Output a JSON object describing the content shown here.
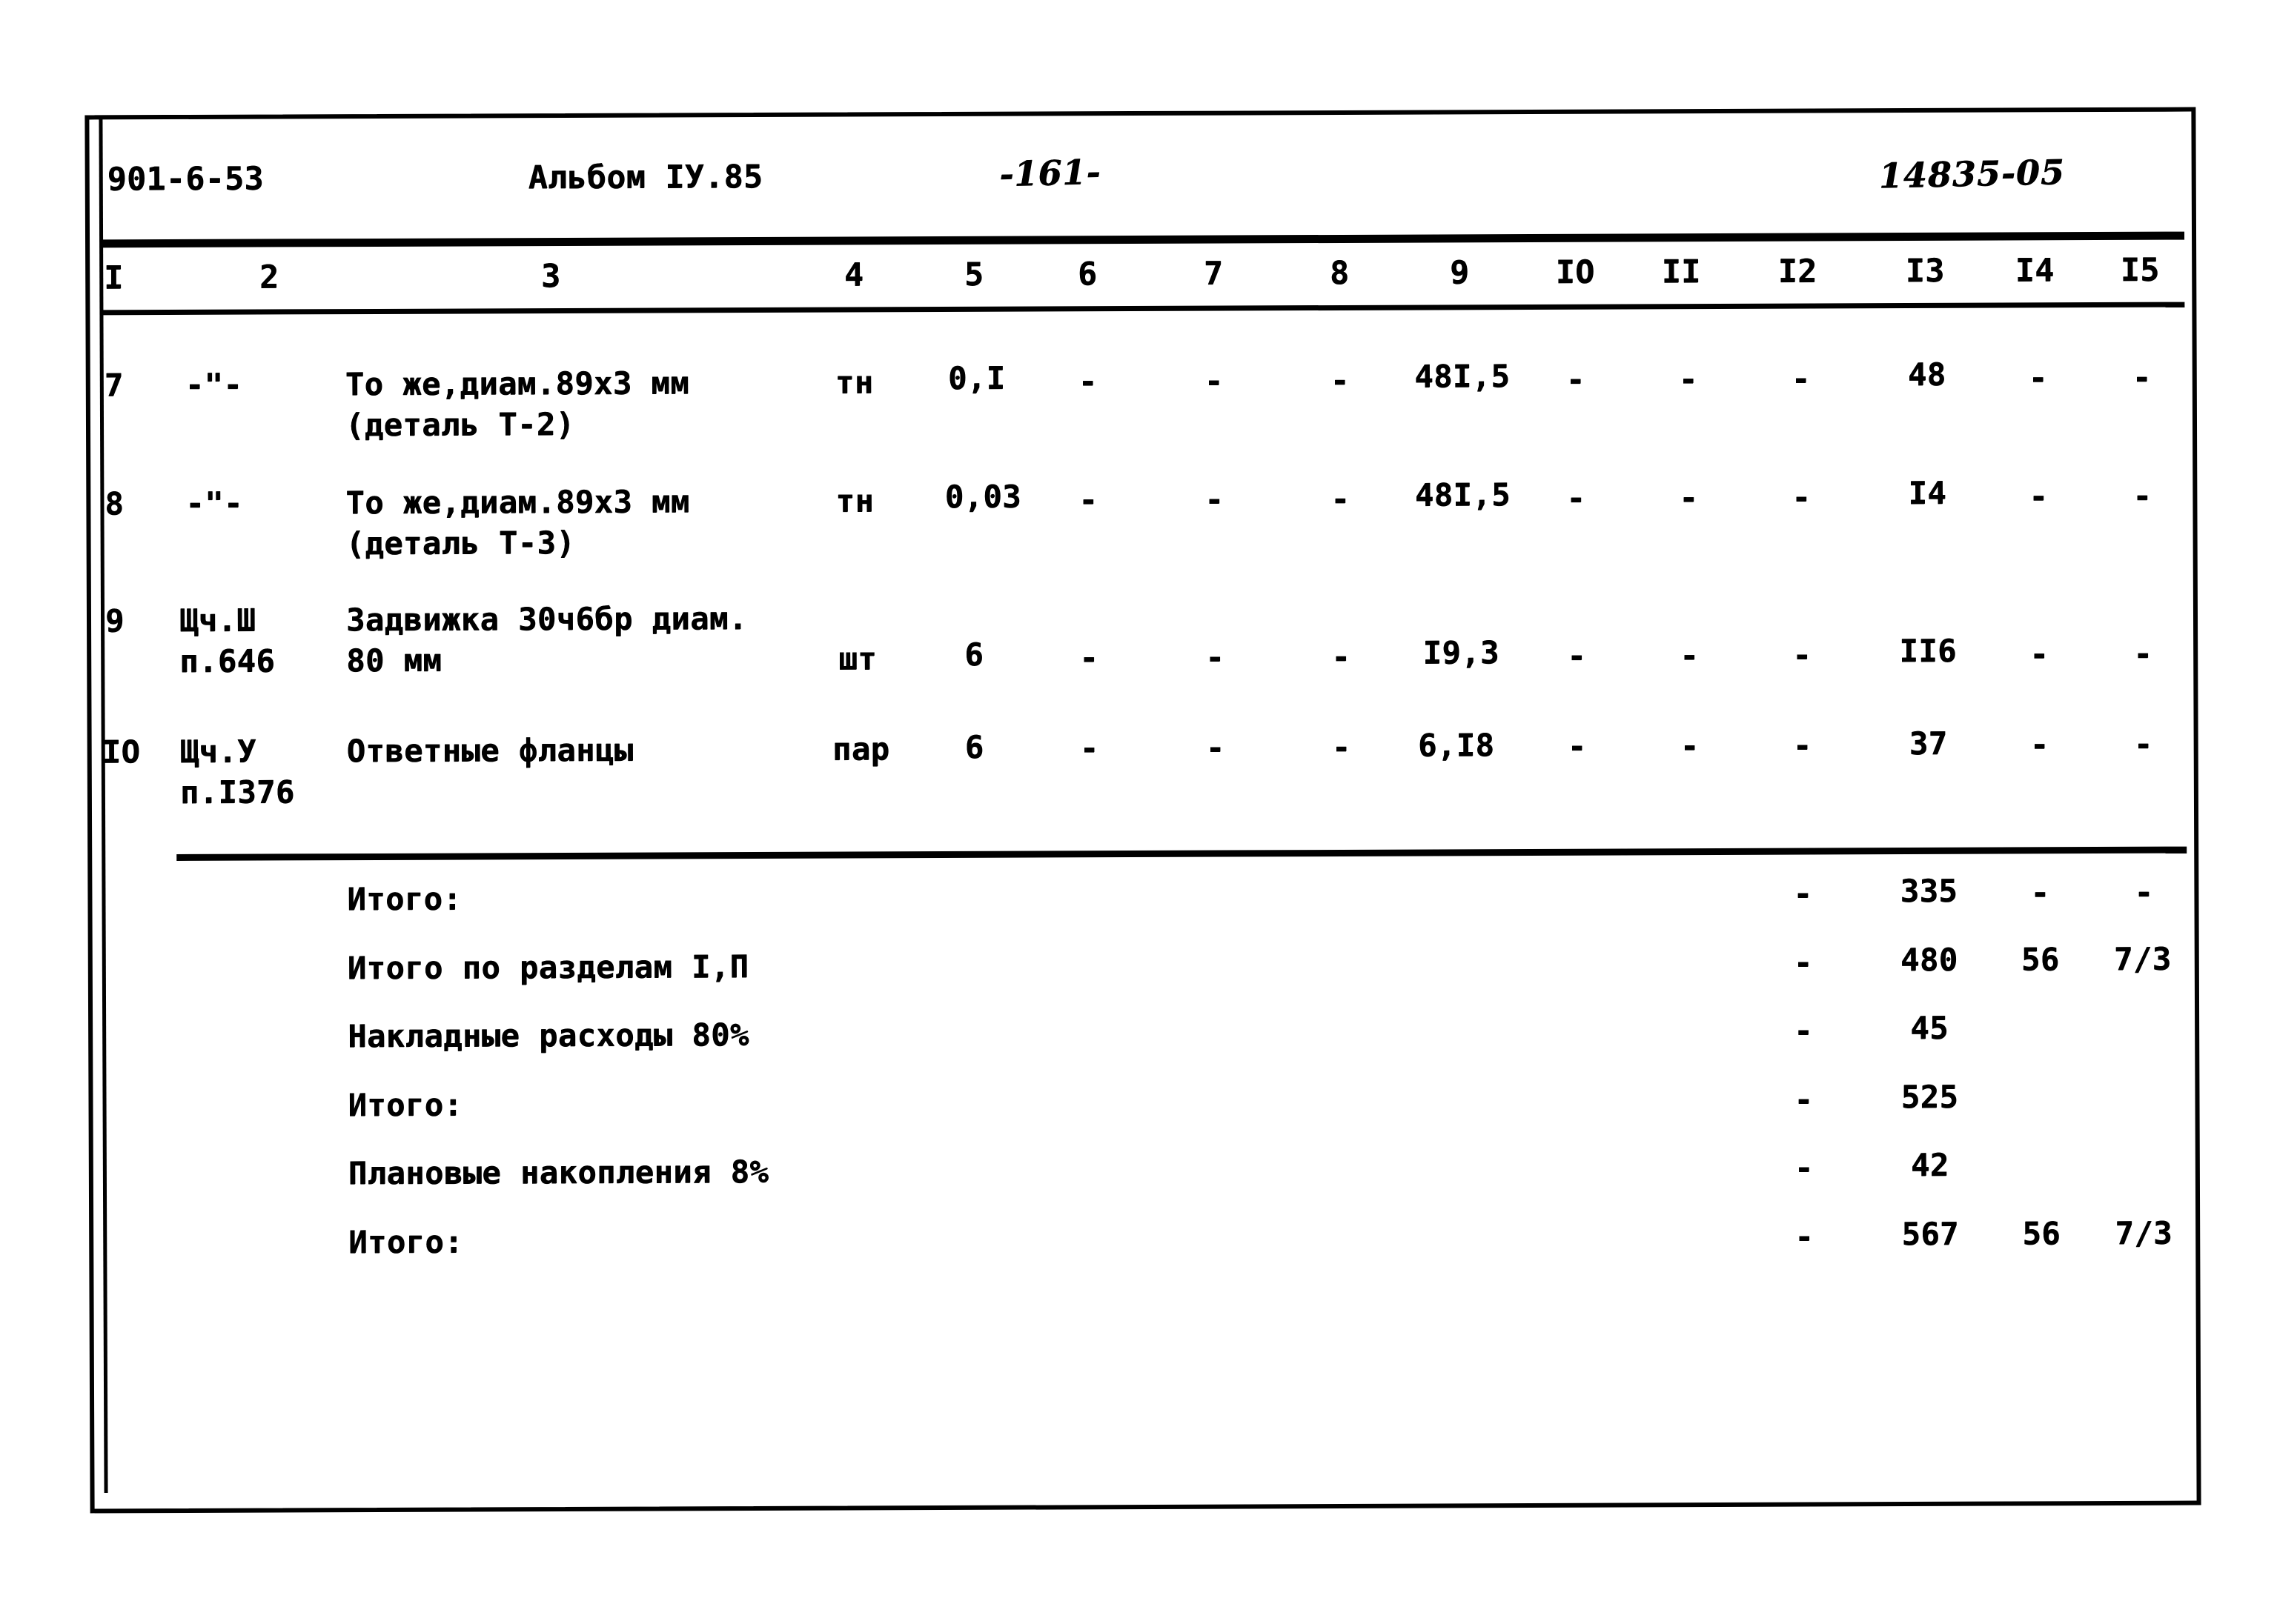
{
  "document": {
    "project_code": "901-6-53",
    "album": "Альбом IУ.85",
    "page_number": "-161-",
    "doc_number": "14835-05"
  },
  "table": {
    "column_headers": [
      "I",
      "2",
      "3",
      "4",
      "5",
      "6",
      "7",
      "8",
      "9",
      "IO",
      "II",
      "I2",
      "I3",
      "I4",
      "I5"
    ],
    "rows": [
      {
        "num": "7",
        "ref": "-\"-",
        "ref_line2": "",
        "name_line1": "То же,диам.89х3 мм",
        "name_line2": "(деталь Т-2)",
        "unit": "тн",
        "c5": "0,I",
        "c6": "-",
        "c7": "-",
        "c8": "-",
        "c9": "48I,5",
        "c10": "-",
        "c11": "-",
        "c12": "-",
        "c13": "48",
        "c14": "-",
        "c15": "-"
      },
      {
        "num": "8",
        "ref": "-\"-",
        "ref_line2": "",
        "name_line1": "То же,диам.89х3 мм",
        "name_line2": "(деталь Т-3)",
        "unit": "тн",
        "c5": "0,03",
        "c6": "-",
        "c7": "-",
        "c8": "-",
        "c9": "48I,5",
        "c10": "-",
        "c11": "-",
        "c12": "-",
        "c13": "I4",
        "c14": "-",
        "c15": "-"
      },
      {
        "num": "9",
        "ref": "Щч.Ш",
        "ref_line2": "п.646",
        "name_line1": "Задвижка 30ч6бр диам.",
        "name_line2": "80 мм",
        "unit": "шт",
        "c5": "6",
        "c6": "-",
        "c7": "-",
        "c8": "-",
        "c9": "I9,3",
        "c10": "-",
        "c11": "-",
        "c12": "-",
        "c13": "II6",
        "c14": "-",
        "c15": "-"
      },
      {
        "num": "IO",
        "ref": "Щч.У",
        "ref_line2": "п.I376",
        "name_line1": "Ответные фланцы",
        "name_line2": "",
        "unit": "пар",
        "c5": "6",
        "c6": "-",
        "c7": "-",
        "c8": "-",
        "c9": "6,I8",
        "c10": "-",
        "c11": "-",
        "c12": "-",
        "c13": "37",
        "c14": "-",
        "c15": "-"
      }
    ],
    "summary": [
      {
        "label": "Итого:",
        "c12": "-",
        "c13": "335",
        "c14": "-",
        "c15": "-"
      },
      {
        "label": "Итого по разделам I,П",
        "c12": "-",
        "c13": "480",
        "c14": "56",
        "c15": "7/3"
      },
      {
        "label": "Накладные расходы 80%",
        "c12": "-",
        "c13": "45",
        "c14": "",
        "c15": ""
      },
      {
        "label": "Итого:",
        "c12": "-",
        "c13": "525",
        "c14": "",
        "c15": ""
      },
      {
        "label": "Плановые накопления 8%",
        "c12": "-",
        "c13": "42",
        "c14": "",
        "c15": ""
      },
      {
        "label": "Итого:",
        "c12": "-",
        "c13": "567",
        "c14": "56",
        "c15": "7/3"
      }
    ]
  }
}
